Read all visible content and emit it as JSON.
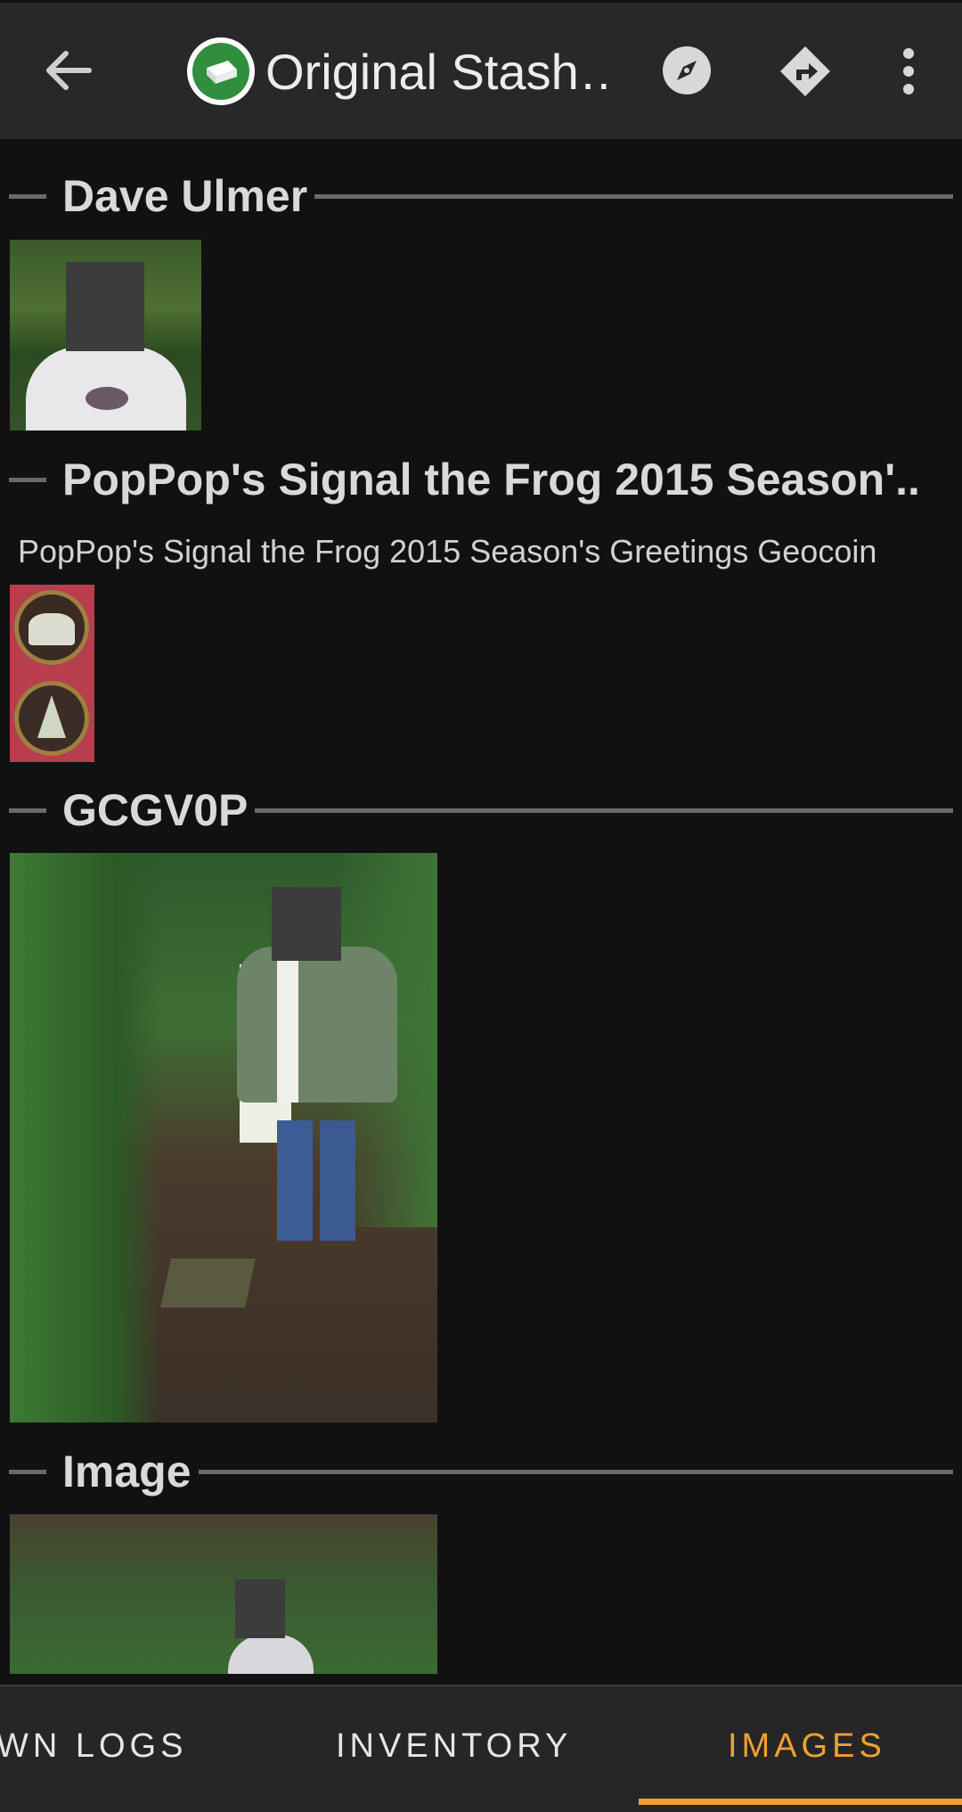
{
  "app_bar": {
    "title": "Original Stash…",
    "accent": "#2f8f3e"
  },
  "sections": [
    {
      "title": "Dave Ulmer"
    },
    {
      "title": "PopPop's Signal the Frog 2015 Season'..",
      "description": "PopPop's Signal the Frog 2015 Season's Greetings Geocoin"
    },
    {
      "title": "GCGV0P"
    },
    {
      "title": "Image"
    }
  ],
  "tabs": {
    "items": [
      "WN LOGS",
      "INVENTORY",
      "IMAGES"
    ],
    "active_color": "#f0a030"
  },
  "icons": [
    "back-arrow-icon",
    "cache-type-icon",
    "compass-icon",
    "navigate-icon",
    "more-vert-icon"
  ]
}
